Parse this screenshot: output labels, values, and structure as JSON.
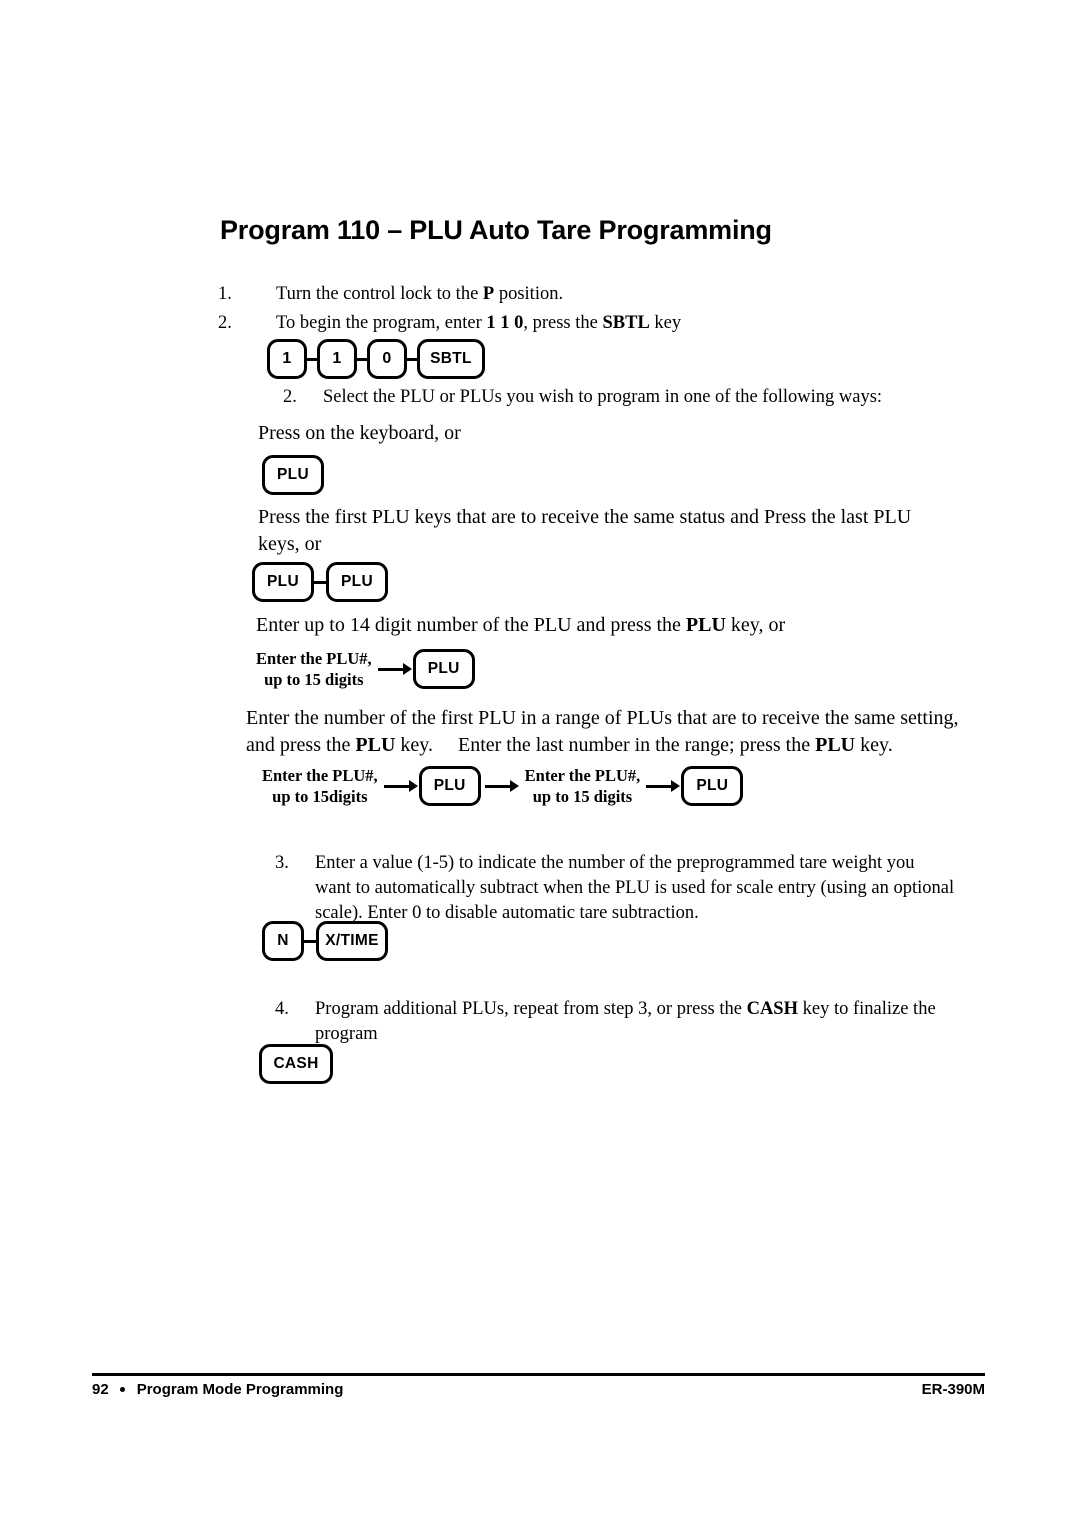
{
  "document": {
    "title": "Program 110 – PLU Auto Tare Programming"
  },
  "steps": {
    "step1": {
      "number": "1.",
      "text_before": "Turn the control lock to the ",
      "bold": "P",
      "text_after": " position."
    },
    "step2": {
      "number": "2.",
      "text_before": "To begin the program, enter ",
      "bold1": "1 1 0",
      "text_mid": ", press the ",
      "bold2": "SBTL",
      "text_after": " key"
    },
    "step2b": {
      "number": "2.",
      "text": "Select the PLU or PLUs you wish to program in one of the following ways:"
    },
    "step3": {
      "number": "3.",
      "text": "Enter a value (1-5) to indicate the number of the preprogrammed tare weight you want to automatically subtract when the PLU is used for scale entry (using an optional scale). Enter 0 to disable automatic tare subtraction."
    },
    "step4": {
      "number": "4.",
      "text_before": "Program additional PLUs, repeat from step 3, or press the ",
      "bold": "CASH",
      "text_after": " key to finalize the program"
    }
  },
  "paragraphs": {
    "keyboard": "Press on the keyboard, or",
    "first_plu": "Press the first PLU keys that are to receive the same status and Press the last PLU keys, or",
    "fourteen_digit": {
      "text_before": "Enter up to 14 digit number of the PLU and press the ",
      "bold": "PLU",
      "text_after": " key, or"
    },
    "range": {
      "part1": "Enter the number of the first PLU in a range of PLUs that are to receive the same setting, and press the ",
      "bold1": "PLU",
      "part2": " key.  Enter the last number in the range; press the ",
      "bold2": "PLU",
      "part3": " key."
    }
  },
  "key_sequences": {
    "begin_program": {
      "keys": [
        "1",
        "1",
        "0",
        "SBTL"
      ]
    },
    "single_plu": {
      "keys": [
        "PLU"
      ]
    },
    "plu_pair": {
      "keys": [
        "PLU",
        "PLU"
      ]
    },
    "enter_plu_single": {
      "caption_line1": "Enter the PLU#,",
      "caption_line2": "up to 15 digits",
      "key": "PLU"
    },
    "enter_plu_range": {
      "first_caption_line1": "Enter the PLU#,",
      "first_caption_line2": "up to 15digits",
      "first_key": "PLU",
      "second_caption_line1": "Enter the PLU#,",
      "second_caption_line2": "up to 15 digits",
      "second_key": "PLU"
    },
    "tare_value": {
      "keys": [
        "N",
        "X/TIME"
      ]
    },
    "finalize": {
      "keys": [
        "CASH"
      ]
    }
  },
  "footer": {
    "page_number": "92",
    "section": "Program Mode Programming",
    "model": "ER-390M"
  }
}
